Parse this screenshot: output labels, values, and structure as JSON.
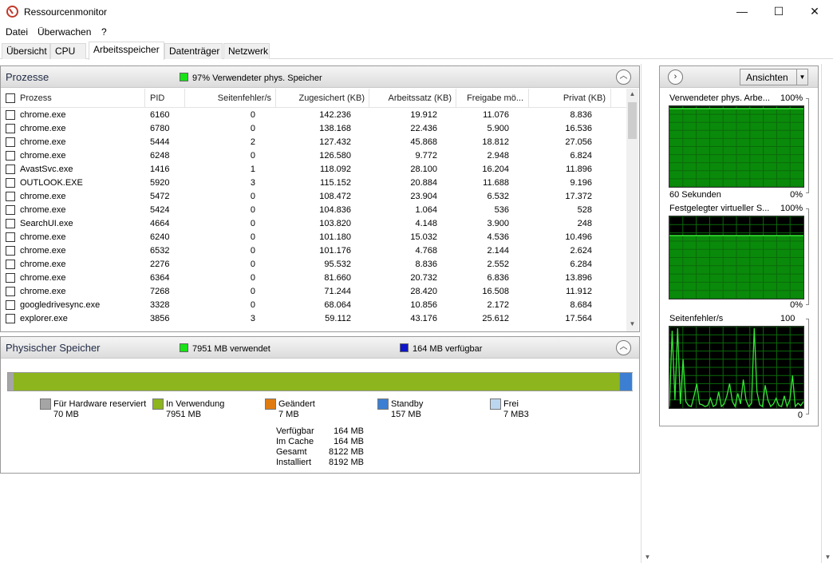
{
  "window": {
    "title": "Ressourcenmonitor",
    "min": "—",
    "max": "☐",
    "close": "✕"
  },
  "menu": [
    "Datei",
    "Überwachen",
    "?"
  ],
  "tabs": [
    "Übersicht",
    "CPU",
    "Arbeitsspeicher",
    "Datenträger",
    "Netzwerk"
  ],
  "active_tab": "Arbeitsspeicher",
  "colors": {
    "used": "#17e317",
    "available": "#0f16c9",
    "graph_line": "#35e835",
    "graph_fill": "#0a8a0a",
    "inuse_bar": "#8db51e",
    "standby_bar": "#3c7fd2",
    "hw_bar": "#a5a5a5",
    "changed_bar": "#e07b12",
    "free_bar": "#bcd6ef"
  },
  "processes": {
    "title": "Prozesse",
    "summary": "97% Verwendeter phys. Speicher",
    "columns": [
      "Prozess",
      "PID",
      "Seitenfehler/s",
      "Zugesichert (KB)",
      "Arbeitssatz (KB)",
      "Freigabe mö...",
      "Privat (KB)"
    ],
    "rows": [
      [
        "chrome.exe",
        "6160",
        "0",
        "142.236",
        "19.912",
        "11.076",
        "8.836"
      ],
      [
        "chrome.exe",
        "6780",
        "0",
        "138.168",
        "22.436",
        "5.900",
        "16.536"
      ],
      [
        "chrome.exe",
        "5444",
        "2",
        "127.432",
        "45.868",
        "18.812",
        "27.056"
      ],
      [
        "chrome.exe",
        "6248",
        "0",
        "126.580",
        "9.772",
        "2.948",
        "6.824"
      ],
      [
        "AvastSvc.exe",
        "1416",
        "1",
        "118.092",
        "28.100",
        "16.204",
        "11.896"
      ],
      [
        "OUTLOOK.EXE",
        "5920",
        "3",
        "115.152",
        "20.884",
        "11.688",
        "9.196"
      ],
      [
        "chrome.exe",
        "5472",
        "0",
        "108.472",
        "23.904",
        "6.532",
        "17.372"
      ],
      [
        "chrome.exe",
        "5424",
        "0",
        "104.836",
        "1.064",
        "536",
        "528"
      ],
      [
        "SearchUI.exe",
        "4664",
        "0",
        "103.820",
        "4.148",
        "3.900",
        "248"
      ],
      [
        "chrome.exe",
        "6240",
        "0",
        "101.180",
        "15.032",
        "4.536",
        "10.496"
      ],
      [
        "chrome.exe",
        "6532",
        "0",
        "101.176",
        "4.768",
        "2.144",
        "2.624"
      ],
      [
        "chrome.exe",
        "2276",
        "0",
        "95.532",
        "8.836",
        "2.552",
        "6.284"
      ],
      [
        "chrome.exe",
        "6364",
        "0",
        "81.660",
        "20.732",
        "6.836",
        "13.896"
      ],
      [
        "chrome.exe",
        "7268",
        "0",
        "71.244",
        "28.420",
        "16.508",
        "11.912"
      ],
      [
        "googledrivesync.exe",
        "3328",
        "0",
        "68.064",
        "10.856",
        "2.172",
        "8.684"
      ],
      [
        "explorer.exe",
        "3856",
        "3",
        "59.112",
        "43.176",
        "25.612",
        "17.564"
      ]
    ]
  },
  "physical": {
    "title": "Physischer Speicher",
    "used_label": "7951 MB verwendet",
    "available_label": "164 MB verfügbar",
    "bar_fractions": {
      "hardware": 0.0085,
      "in_use": 0.9703,
      "changed": 0.0009,
      "standby": 0.0192,
      "free": 0.0011
    },
    "legend": [
      {
        "label": "Für Hardware reserviert",
        "value": "70 MB",
        "color": "#a5a5a5"
      },
      {
        "label": "In Verwendung",
        "value": "7951 MB",
        "color": "#8db51e"
      },
      {
        "label": "Geändert",
        "value": "7 MB",
        "color": "#e07b12"
      },
      {
        "label": "Standby",
        "value": "157 MB",
        "color": "#3c7fd2"
      },
      {
        "label": "Frei",
        "value": "7 MB3",
        "color": "#bcd6ef"
      }
    ],
    "stats": [
      {
        "k": "Verfügbar",
        "v": "164 MB"
      },
      {
        "k": "Im Cache",
        "v": "164 MB"
      },
      {
        "k": "Gesamt",
        "v": "8122 MB"
      },
      {
        "k": "Installiert",
        "v": "8192 MB"
      }
    ]
  },
  "side": {
    "views_label": "Ansichten",
    "graphs": [
      {
        "label": "Verwendeter phys. Arbe...",
        "max": "100%",
        "bottom_left": "60 Sekunden",
        "bottom_right": "0%",
        "level": 0.97
      },
      {
        "label": "Festgelegter virtueller S...",
        "max": "100%",
        "bottom_left": "",
        "bottom_right": "0%",
        "level": 0.77
      },
      {
        "label": "Seitenfehler/s",
        "max": "100",
        "bottom_left": "",
        "bottom_right": "0",
        "spikes": [
          0.02,
          0.95,
          0.1,
          0.98,
          0.05,
          0.6,
          0.08,
          0.03,
          0.02,
          0.15,
          0.3,
          0.05,
          0.04,
          0.02,
          0.03,
          0.12,
          0.02,
          0.04,
          0.2,
          0.02,
          0.05,
          0.15,
          0.3,
          0.08,
          0.02,
          0.18,
          0.05,
          0.35,
          0.1,
          0.02,
          0.06,
          0.98,
          0.2,
          0.04,
          0.02,
          0.28,
          0.1,
          0.02,
          0.05,
          0.12,
          0.03,
          0.02,
          0.15,
          0.02,
          0.1,
          0.4,
          0.02,
          0.06,
          0.03,
          0.08
        ]
      }
    ]
  }
}
